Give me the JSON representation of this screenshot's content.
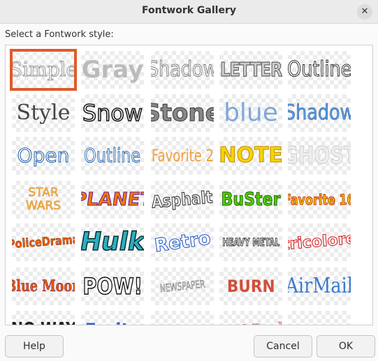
{
  "window": {
    "title": "Fontwork Gallery",
    "close_glyph": "✕"
  },
  "prompt": "Select a Fontwork style:",
  "gallery": {
    "rows": [
      [
        {
          "text": "Simple",
          "selected": true
        },
        {
          "text": "Gray"
        },
        {
          "text": "Shadow"
        },
        {
          "text": "LETTER"
        },
        {
          "text": "Outline"
        }
      ],
      [
        {
          "text": "Style"
        },
        {
          "text": "Snow"
        },
        {
          "text": "Stone"
        },
        {
          "text": "blue"
        },
        {
          "text": "Shadow"
        }
      ],
      [
        {
          "text": "Open"
        },
        {
          "text": "Outline"
        },
        {
          "text": "Favorite 2"
        },
        {
          "text": "NOTE"
        },
        {
          "text": "GHOST"
        }
      ],
      [
        {
          "text": "STAR WARS"
        },
        {
          "text": "PLANET"
        },
        {
          "text": "Asphalt"
        },
        {
          "text": "BuSter"
        },
        {
          "text": "Favorite 16"
        }
      ],
      [
        {
          "text": "PoliceDrama"
        },
        {
          "text": "Hulk"
        },
        {
          "text": "Retro"
        },
        {
          "text": "HEAVY METAL"
        },
        {
          "text": "tricolore"
        }
      ],
      [
        {
          "text": "Blue Moon"
        },
        {
          "text": "POW!"
        },
        {
          "text": "NEWSPAPER"
        },
        {
          "text": "BURN"
        },
        {
          "text": "AirMail"
        }
      ],
      [
        {
          "text": "NO WAY"
        },
        {
          "text": "Fruity"
        },
        {
          "text": ""
        },
        {
          "text": "Gold Rush"
        },
        {
          "text": ""
        }
      ]
    ]
  },
  "buttons": {
    "help": "Help",
    "cancel": "Cancel",
    "ok": "OK"
  },
  "colors": {
    "selection": "#e05a2c",
    "titlebar": "#ebebeb"
  }
}
